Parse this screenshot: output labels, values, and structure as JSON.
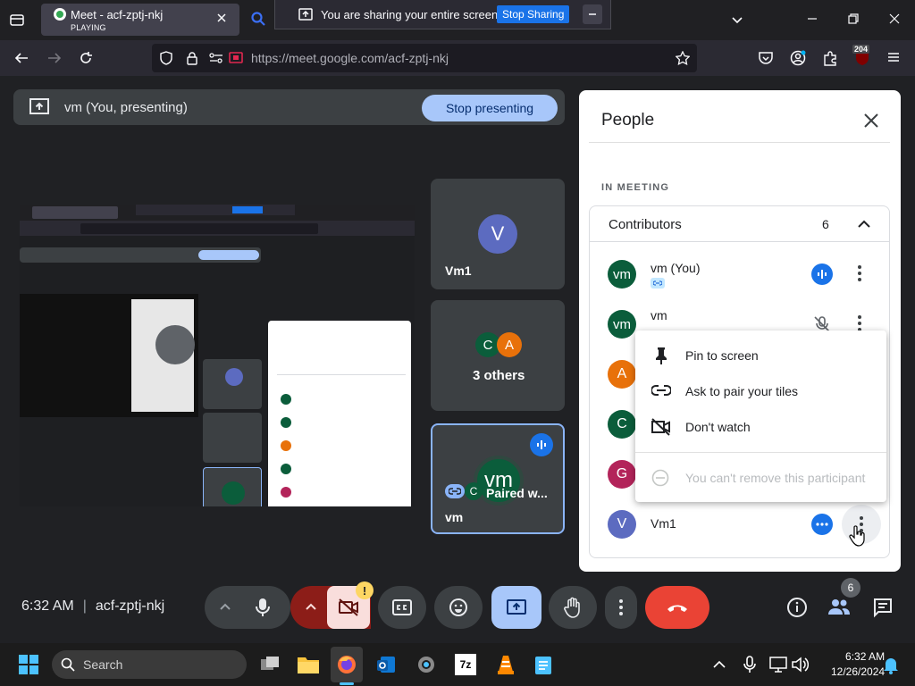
{
  "browser": {
    "tab_title": "Meet - acf-zptj-nkj",
    "tab_status": "PLAYING",
    "share_notice": "You are sharing your entire screen.",
    "stop_sharing_label": "Stop Sharing",
    "url": "https://meet.google.com/acf-zptj-nkj",
    "badge_count": "204"
  },
  "meet": {
    "presenting_label": "vm (You, presenting)",
    "stop_presenting_label": "Stop presenting",
    "tiles": [
      {
        "initial": "V",
        "name": "Vm1"
      },
      {
        "initials": [
          "C",
          "A"
        ],
        "name": "3 others"
      },
      {
        "initial": "vm",
        "name": "vm",
        "paired_label": "Paired w...",
        "paired_initial": "C"
      }
    ],
    "time": "6:32 AM",
    "meeting_code": "acf-zptj-nkj",
    "people_count": "6",
    "colors": {
      "accent": "#1a73e8",
      "end_call": "#ea4335",
      "blue_light": "#a8c7fa"
    }
  },
  "people_panel": {
    "title": "People",
    "section": "IN MEETING",
    "contributors_label": "Contributors",
    "contributors_count": "6",
    "participants": [
      {
        "initial": "vm",
        "name": "vm (You)",
        "color": "#0b5d3b"
      },
      {
        "initial": "vm",
        "name": "vm",
        "color": "#0b5d3b"
      },
      {
        "initial": "A",
        "name": "",
        "color": "#e8710a"
      },
      {
        "initial": "C",
        "name": "",
        "color": "#0b5d3b"
      },
      {
        "initial": "G",
        "name": "",
        "color": "#b3245a"
      },
      {
        "initial": "V",
        "name": "Vm1",
        "color": "#5c6bc0"
      }
    ],
    "menu": {
      "pin": "Pin to screen",
      "pair": "Ask to pair your tiles",
      "dont_watch": "Don't watch",
      "remove": "You can't remove this participant"
    }
  },
  "taskbar": {
    "search_placeholder": "Search",
    "time": "6:32 AM",
    "date": "12/26/2024"
  }
}
